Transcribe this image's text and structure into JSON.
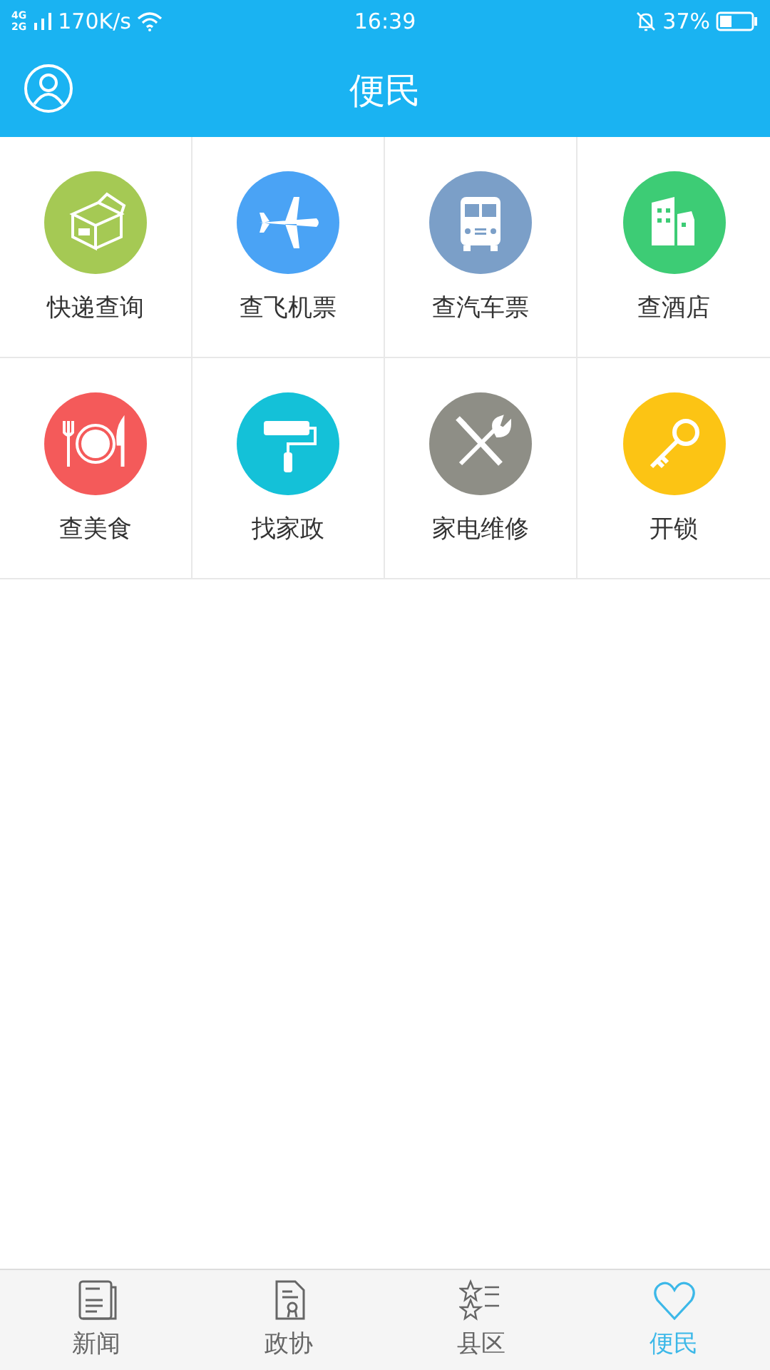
{
  "status_bar": {
    "network_top": "4G",
    "network_bottom": "2G",
    "speed": "170K/s",
    "time": "16:39",
    "battery": "37%"
  },
  "header": {
    "title": "便民"
  },
  "tiles": [
    {
      "label": "快递查询",
      "kind": "box",
      "color": "#a5c954"
    },
    {
      "label": "查飞机票",
      "kind": "plane",
      "color": "#4aa3f5"
    },
    {
      "label": "查汽车票",
      "kind": "bus",
      "color": "#7b9fc8"
    },
    {
      "label": "查酒店",
      "kind": "building",
      "color": "#3dcc75"
    },
    {
      "label": "查美食",
      "kind": "food",
      "color": "#f45a5a"
    },
    {
      "label": "找家政",
      "kind": "roller",
      "color": "#14c1d8"
    },
    {
      "label": "家电维修",
      "kind": "tools",
      "color": "#8e8e86"
    },
    {
      "label": "开锁",
      "kind": "key",
      "color": "#fcc414"
    }
  ],
  "tabs": [
    {
      "label": "新闻",
      "kind": "news",
      "selected": false
    },
    {
      "label": "政协",
      "kind": "document",
      "selected": false
    },
    {
      "label": "县区",
      "kind": "stars",
      "selected": false
    },
    {
      "label": "便民",
      "kind": "heart",
      "selected": true
    }
  ]
}
